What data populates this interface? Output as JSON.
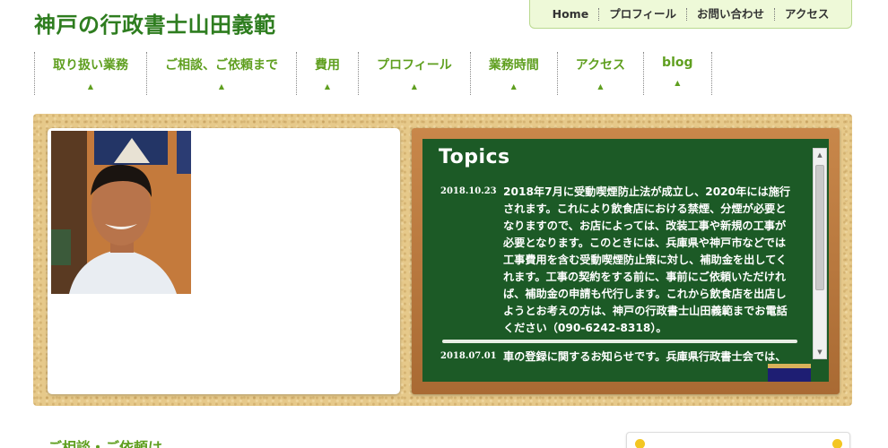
{
  "site": {
    "title": "神戸の行政書士山田義範"
  },
  "top_nav": {
    "items": [
      "Home",
      "プロフィール",
      "お問い合わせ",
      "アクセス"
    ]
  },
  "main_nav": {
    "items": [
      {
        "label": "取り扱い業務"
      },
      {
        "label": "ご相談、ご依頼まで"
      },
      {
        "label": "費用"
      },
      {
        "label": "プロフィール"
      },
      {
        "label": "業務時間"
      },
      {
        "label": "アクセス"
      },
      {
        "label": "blog"
      }
    ],
    "marker": "▲"
  },
  "topics": {
    "title": "Topics",
    "items": [
      {
        "date": "2018.10.23",
        "lines": [
          "2018年7月に受動喫煙防止法が成立し、2020年には施行",
          "されます。これにより飲食店における禁煙、分煙が必要と",
          "なりますので、お店によっては、改装工事や新規の工事が",
          "必要となります。このときには、兵庫県や神戸市などでは",
          "工事費用を含む受動喫煙防止策に対し、補助金を出してく",
          "れます。工事の契約をする前に、事前にご依頼いただけれ",
          "ば、補助金の申請も代行します。これから飲食店を出店し",
          "ようとお考えの方は、神戸の行政書士山田義範までお電話",
          "ください（090-6242-8318）。"
        ]
      },
      {
        "date": "2018.07.01",
        "lines": [
          "車の登録に関するお知らせです。兵庫県行政書士会では、"
        ]
      }
    ]
  },
  "section": {
    "heading": "ご相談・ご依頼は"
  },
  "colors": {
    "brand_green": "#2e7d1f",
    "nav_green": "#5f9f1f",
    "board_green": "#1c5a26",
    "cork": "#e6c98a"
  },
  "icons": {
    "nav_marker": "triangle-up-icon",
    "scroll_up": "scroll-up-arrow-icon",
    "scroll_down": "scroll-down-arrow-icon"
  }
}
